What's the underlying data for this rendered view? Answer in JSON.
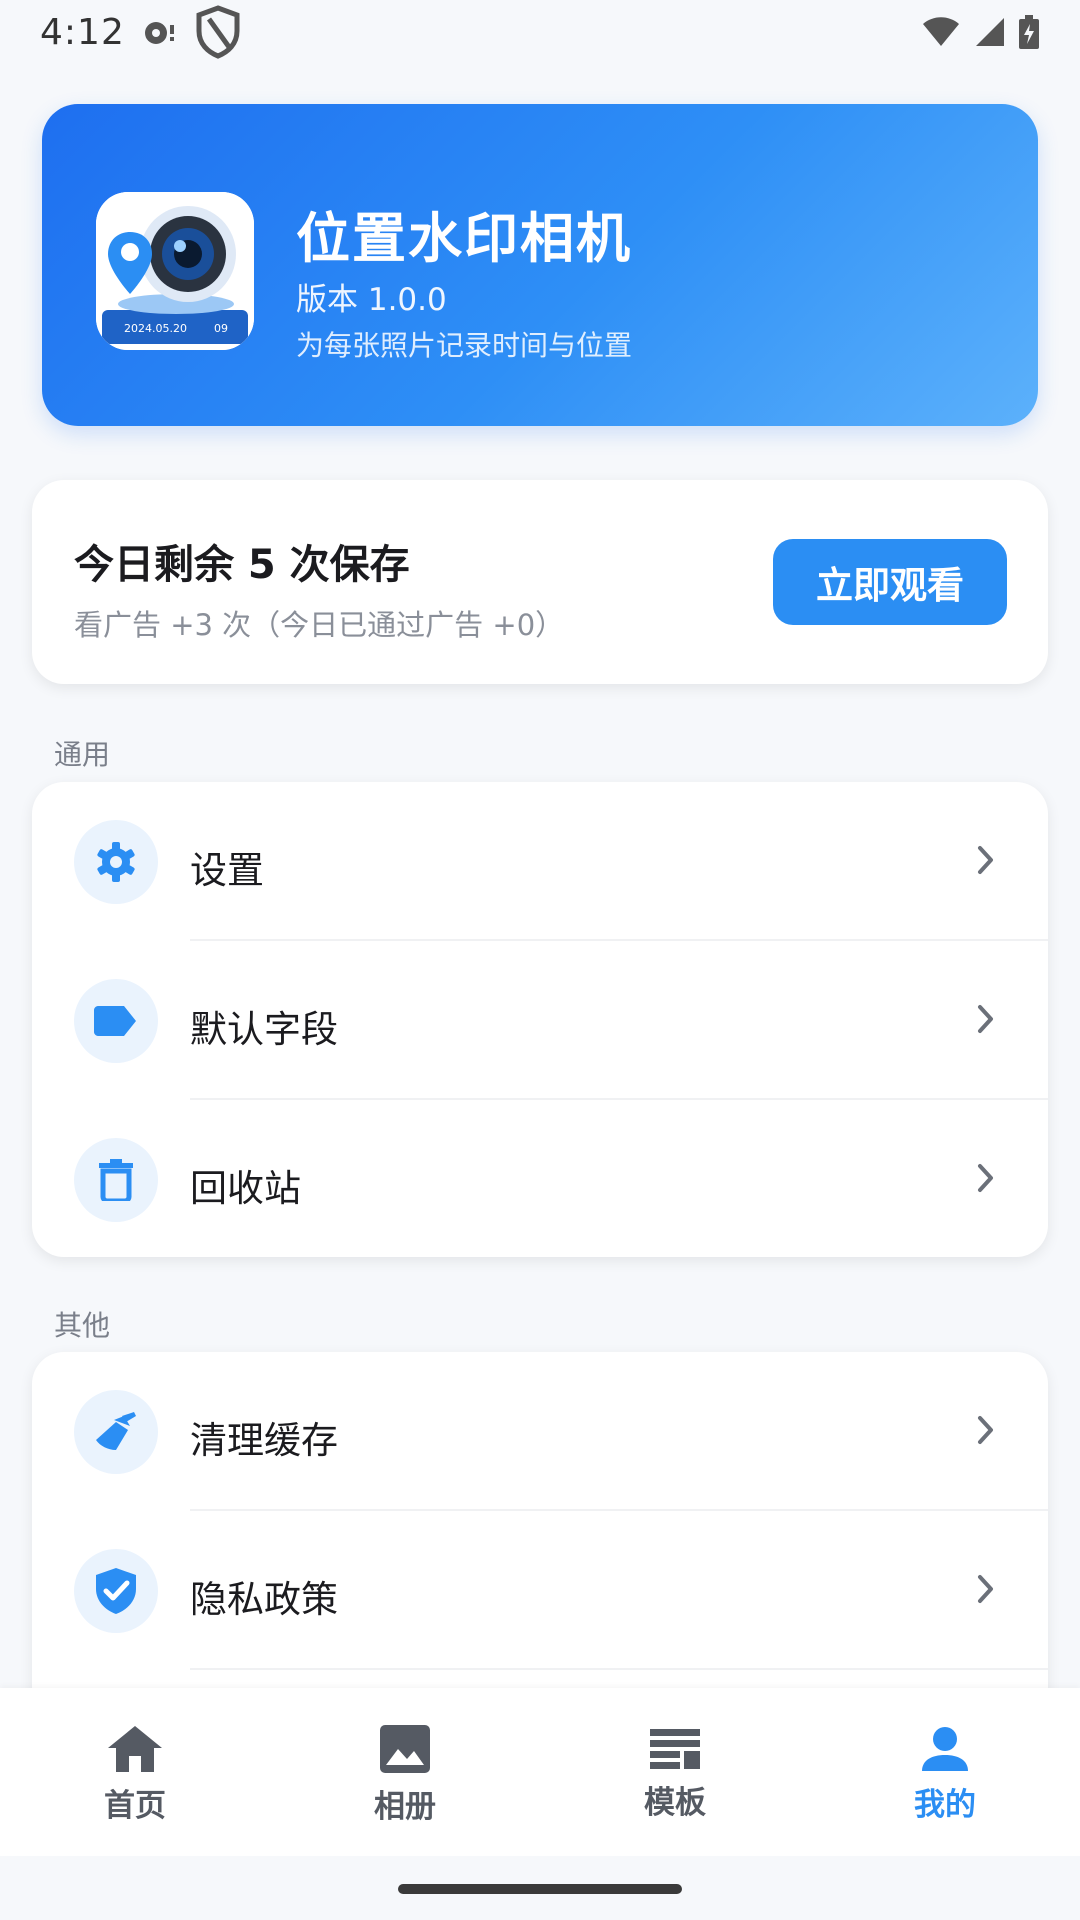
{
  "status_bar": {
    "time": "4:12"
  },
  "header": {
    "app_name": "位置水印相机",
    "version": "版本 1.0.0",
    "tagline": "为每张照片记录时间与位置",
    "icon_date_text": "2024.05.20",
    "icon_extra_text": "09"
  },
  "quota": {
    "title": "今日剩余 5 次保存",
    "subtitle": "看广告 +3 次（今日已通过广告 +0）",
    "button_label": "立即观看"
  },
  "sections": {
    "general": {
      "label": "通用",
      "items": [
        {
          "label": "设置",
          "icon": "gear-icon"
        },
        {
          "label": "默认字段",
          "icon": "tag-icon"
        },
        {
          "label": "回收站",
          "icon": "trash-icon"
        }
      ]
    },
    "other": {
      "label": "其他",
      "items": [
        {
          "label": "清理缓存",
          "icon": "broom-icon"
        },
        {
          "label": "隐私政策",
          "icon": "shield-check-icon"
        }
      ]
    }
  },
  "bottom_nav": {
    "items": [
      {
        "label": "首页",
        "icon": "home-icon",
        "active": false
      },
      {
        "label": "相册",
        "icon": "image-icon",
        "active": false
      },
      {
        "label": "模板",
        "icon": "template-icon",
        "active": false
      },
      {
        "label": "我的",
        "icon": "person-icon",
        "active": true
      }
    ]
  },
  "colors": {
    "accent": "#2b8ef3",
    "hero_gradient_start": "#1e6ff0",
    "hero_gradient_end": "#5cb1fb",
    "icon_bg": "#eaf3fd",
    "background": "#f6f8fb"
  }
}
